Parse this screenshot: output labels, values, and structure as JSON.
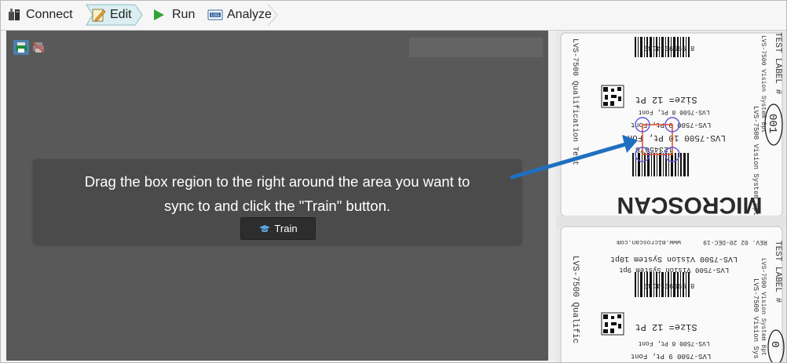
{
  "toolbar": {
    "steps": [
      {
        "label": "Connect",
        "icon": "connect-icon"
      },
      {
        "label": "Edit",
        "icon": "edit-icon",
        "active": true
      },
      {
        "label": "Run",
        "icon": "run-icon"
      },
      {
        "label": "Analyze",
        "icon": "analyze-icon",
        "badge": "LOG"
      }
    ]
  },
  "instruction": {
    "line1": "Drag the box region to the right around the area you want to",
    "line2": "sync to and click the \"Train\" button.",
    "train_label": "Train"
  },
  "label_top": {
    "digits": "8 9999914149",
    "size_line": "Size= 12 Pt",
    "small_line": "LVS-7500 8 Pt, Font",
    "line_9": "LVS-7500 9 Pt, Font",
    "line_10": "LVS-7500 10 Pt, Font",
    "serial": "12345678",
    "brand": "MICROSCAN",
    "left_vertical": "LVS-7500 Qualification Test",
    "right_vertical_1": "TEST LABEL #",
    "right_vertical_2": "LVS-7500 Vision System 8pt",
    "right_vertical_3": "LVS-7500 Vision System 9pt",
    "badge_num": "001"
  },
  "label_bottom": {
    "rev": "REV. 02 20-DEC-19",
    "url": "www.microscan.com",
    "line_10pt": "LVS-7500 Vision System 10pt",
    "line_9pt": "LVS-7500 Vision System 9pt",
    "digits": "8 9999914149",
    "size_line": "Size= 12 Pt",
    "small_line": "LVS-7500 8 Pt, Font",
    "line_9": "LVS-7500 9 Pt, Font",
    "left_vertical": "LVS-7500 Qualific",
    "right_vertical_1": "TEST LABEL #",
    "right_vertical_2": "LVS-7500 Vision System 8pt",
    "right_vertical_3": "LVS-7500 Vision Sys",
    "badge_num": "0"
  },
  "colors": {
    "workspace": "#595959",
    "panel": "#4b4b4b",
    "arrow": "#1f6fc0",
    "train_button": "#2d2d2d",
    "run_green": "#2fa337",
    "sync_box": "#e4552c",
    "sync_circles": "#5a5adc"
  }
}
